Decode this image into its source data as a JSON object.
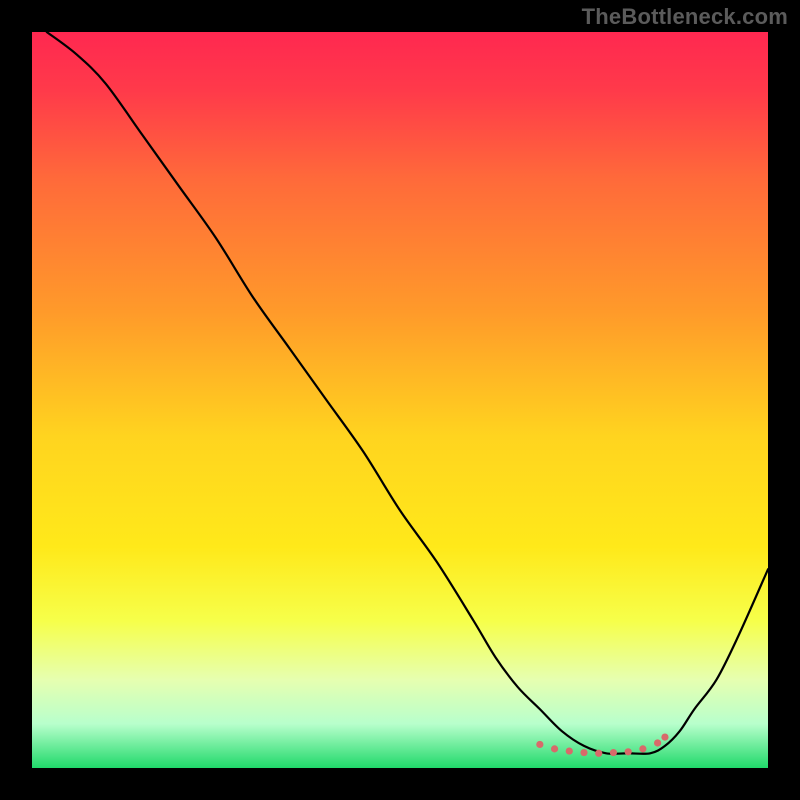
{
  "watermark": {
    "text": "TheBottleneck.com"
  },
  "chart_data": {
    "type": "line",
    "title": "",
    "xlabel": "",
    "ylabel": "",
    "xlim": [
      0,
      100
    ],
    "ylim": [
      0,
      100
    ],
    "grid": false,
    "gradient_stops": [
      {
        "offset": 0.0,
        "color": "#ff2850"
      },
      {
        "offset": 0.08,
        "color": "#ff3a4a"
      },
      {
        "offset": 0.2,
        "color": "#ff6a3a"
      },
      {
        "offset": 0.38,
        "color": "#ff9a2a"
      },
      {
        "offset": 0.55,
        "color": "#ffd41f"
      },
      {
        "offset": 0.7,
        "color": "#ffe91a"
      },
      {
        "offset": 0.8,
        "color": "#f6ff4a"
      },
      {
        "offset": 0.88,
        "color": "#e6ffb0"
      },
      {
        "offset": 0.94,
        "color": "#b8ffcc"
      },
      {
        "offset": 1.0,
        "color": "#20d96a"
      }
    ],
    "series": [
      {
        "name": "bottleneck-curve",
        "x": [
          2,
          6,
          10,
          15,
          20,
          25,
          30,
          35,
          40,
          45,
          50,
          55,
          60,
          63,
          66,
          69,
          72,
          75,
          78,
          81,
          84,
          86,
          88,
          90,
          93,
          96,
          100
        ],
        "y": [
          100,
          97,
          93,
          86,
          79,
          72,
          64,
          57,
          50,
          43,
          35,
          28,
          20,
          15,
          11,
          8,
          5,
          3,
          2,
          2,
          2,
          3,
          5,
          8,
          12,
          18,
          27
        ]
      },
      {
        "name": "optimal-band-markers",
        "x": [
          69,
          71,
          73,
          75,
          77,
          79,
          81,
          83,
          85,
          86
        ],
        "y": [
          3.2,
          2.6,
          2.3,
          2.1,
          2.0,
          2.1,
          2.2,
          2.6,
          3.4,
          4.2
        ]
      }
    ],
    "curve_stroke": "#000000",
    "curve_width": 2.2,
    "marker_color": "#d86a6a",
    "marker_radius": 3.6
  }
}
